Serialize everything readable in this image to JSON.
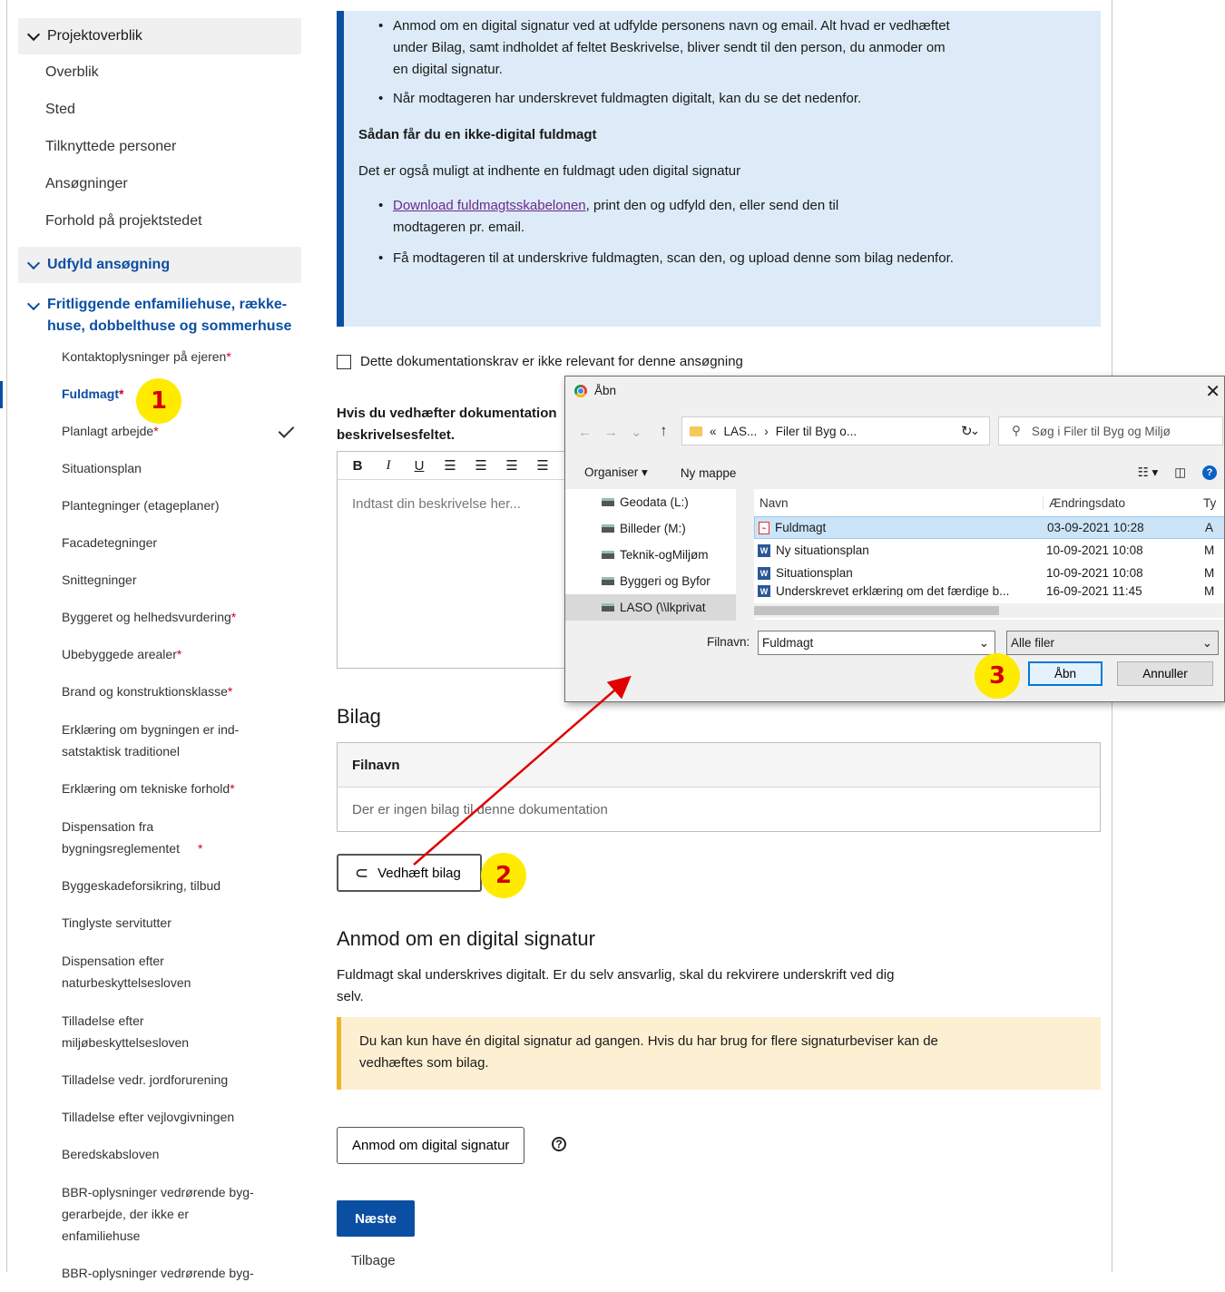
{
  "sidebar": {
    "section1": "Projektoverblik",
    "items1": [
      "Overblik",
      "Sted",
      "Tilknyttede personer",
      "Ansøgninger",
      "Forhold på projektstedet"
    ],
    "section2": "Udfyld ansøgning",
    "group": "Fritliggende enfamiliehuse, række-huse, dobbelthuse og sommerhuse",
    "req_mark": "*",
    "items2": [
      {
        "label": "Kontaktoplysninger på ejeren",
        "req": "*"
      },
      {
        "label": "Fuldmagt",
        "req": "*"
      },
      {
        "label": "Planlagt arbejde",
        "req": "*"
      },
      {
        "label": "Situationsplan"
      },
      {
        "label": "Plantegninger (etageplaner)"
      },
      {
        "label": "Facadetegninger"
      },
      {
        "label": "Snittegninger"
      },
      {
        "label": "Byggeret og helhedsvurdering",
        "req": "*"
      },
      {
        "label": "Ubebyggede arealer",
        "req": "*"
      },
      {
        "label": "Brand og konstruktionsklasse",
        "req": "*"
      },
      {
        "label": "Erklæring om bygningen er ind-satstaktisk traditionel"
      },
      {
        "label": "Erklæring om tekniske forhold",
        "req": "*"
      },
      {
        "label": "Dispensation fra bygningsreglementet",
        "req": "*"
      },
      {
        "label": "Byggeskadeforsikring, tilbud"
      },
      {
        "label": "Tinglyste servitutter"
      },
      {
        "label": "Dispensation efter naturbeskyttelsesloven"
      },
      {
        "label": "Tilladelse efter miljøbeskyttelsesloven"
      },
      {
        "label": "Tilladelse vedr. jordforurening"
      },
      {
        "label": "Tilladelse efter vejlovgivningen"
      },
      {
        "label": "Beredskabsloven"
      },
      {
        "label": "BBR-oplysninger vedrørende byg-gerarbejde, der ikke er enfamiliehuse"
      },
      {
        "label": "BBR-oplysninger vedrørende byg-"
      }
    ]
  },
  "info": {
    "bullet1": "Anmod om en digital signatur ved at udfylde personens navn og email. Alt hvad er vedhæftet under Bilag, samt indholdet af feltet Beskrivelse, bliver sendt til den person, du anmoder om en digital signatur.",
    "bullet2": "Når modtageren har underskrevet fuldmagten digitalt, kan du se det nedenfor.",
    "heading": "Sådan får du en ikke-digital fuldmagt",
    "paragraph": "Det er også muligt at indhente en fuldmagt uden digital signatur",
    "link": "Download fuldmagtsskabelonen",
    "bullet3_rest": ", print den og udfyld den, eller send den til modtageren pr. email.",
    "bullet4": "Få modtageren til at underskrive fuldmagten, scan den, og upload denne som bilag nedenfor."
  },
  "not_relevant": "Dette dokumentationskrav er ikke relevant for denne ansøgning",
  "desc_label": "Hvis du vedhæfter dokumentation beskrivelsesfeltet.",
  "editor": {
    "tools": [
      "B",
      "I",
      "U",
      "☰",
      "☰",
      "☰",
      "☰"
    ],
    "placeholder": "Indtast din beskrivelse her..."
  },
  "bilag": {
    "title": "Bilag",
    "col": "Filnavn",
    "empty": "Der er ingen bilag til denne dokumentation",
    "attach": "Vedhæft bilag"
  },
  "signature": {
    "title": "Anmod om en digital signatur",
    "text": "Fuldmagt skal underskrives digitalt. Er du selv ansvarlig, skal du rekvirere underskrift ved dig selv.",
    "warning": "Du kan kun have én digital signatur ad gangen. Hvis du har brug for flere signaturbeviser kan de vedhæftes som bilag.",
    "button": "Anmod om digital signatur",
    "help": "?"
  },
  "next": "Næste",
  "back": "Tilbage",
  "dialog": {
    "title": "Åbn",
    "close": "✕",
    "path": [
      "«",
      "LAS...",
      "›",
      "Filer til Byg o..."
    ],
    "search": "Søg i Filer til Byg og Miljø",
    "organize": "Organiser ▾",
    "new_folder": "Ny mappe",
    "help": "?",
    "drives": [
      "Geodata (L:)",
      "Billeder (M:)",
      "Teknik-ogMiljøm",
      "Byggeri og Byfor",
      "LASO (\\\\lkprivat"
    ],
    "col_name": "Navn",
    "col_date": "Ændringsdato",
    "col_type": "Ty",
    "files": [
      {
        "name": "Fuldmagt",
        "date": "03-09-2021 10:28",
        "type": "A"
      },
      {
        "name": "Ny situationsplan",
        "date": "10-09-2021 10:08",
        "type": "M"
      },
      {
        "name": "Situationsplan",
        "date": "10-09-2021 10:08",
        "type": "M"
      },
      {
        "name": "Underskrevet erklæring om det færdige b...",
        "date": "16-09-2021 11:45",
        "type": "M"
      }
    ],
    "filename_label": "Filnavn:",
    "filename": "Fuldmagt",
    "filetype": "Alle filer",
    "open": "Åbn",
    "cancel": "Annuller"
  },
  "annotations": [
    "1",
    "2",
    "3"
  ],
  "colors": {
    "primary": "#0b4fa3",
    "info_bg": "#dcebf7",
    "warn_bg": "#fdefd2",
    "badge": "#ffeb00",
    "arrow": "#e00000"
  }
}
